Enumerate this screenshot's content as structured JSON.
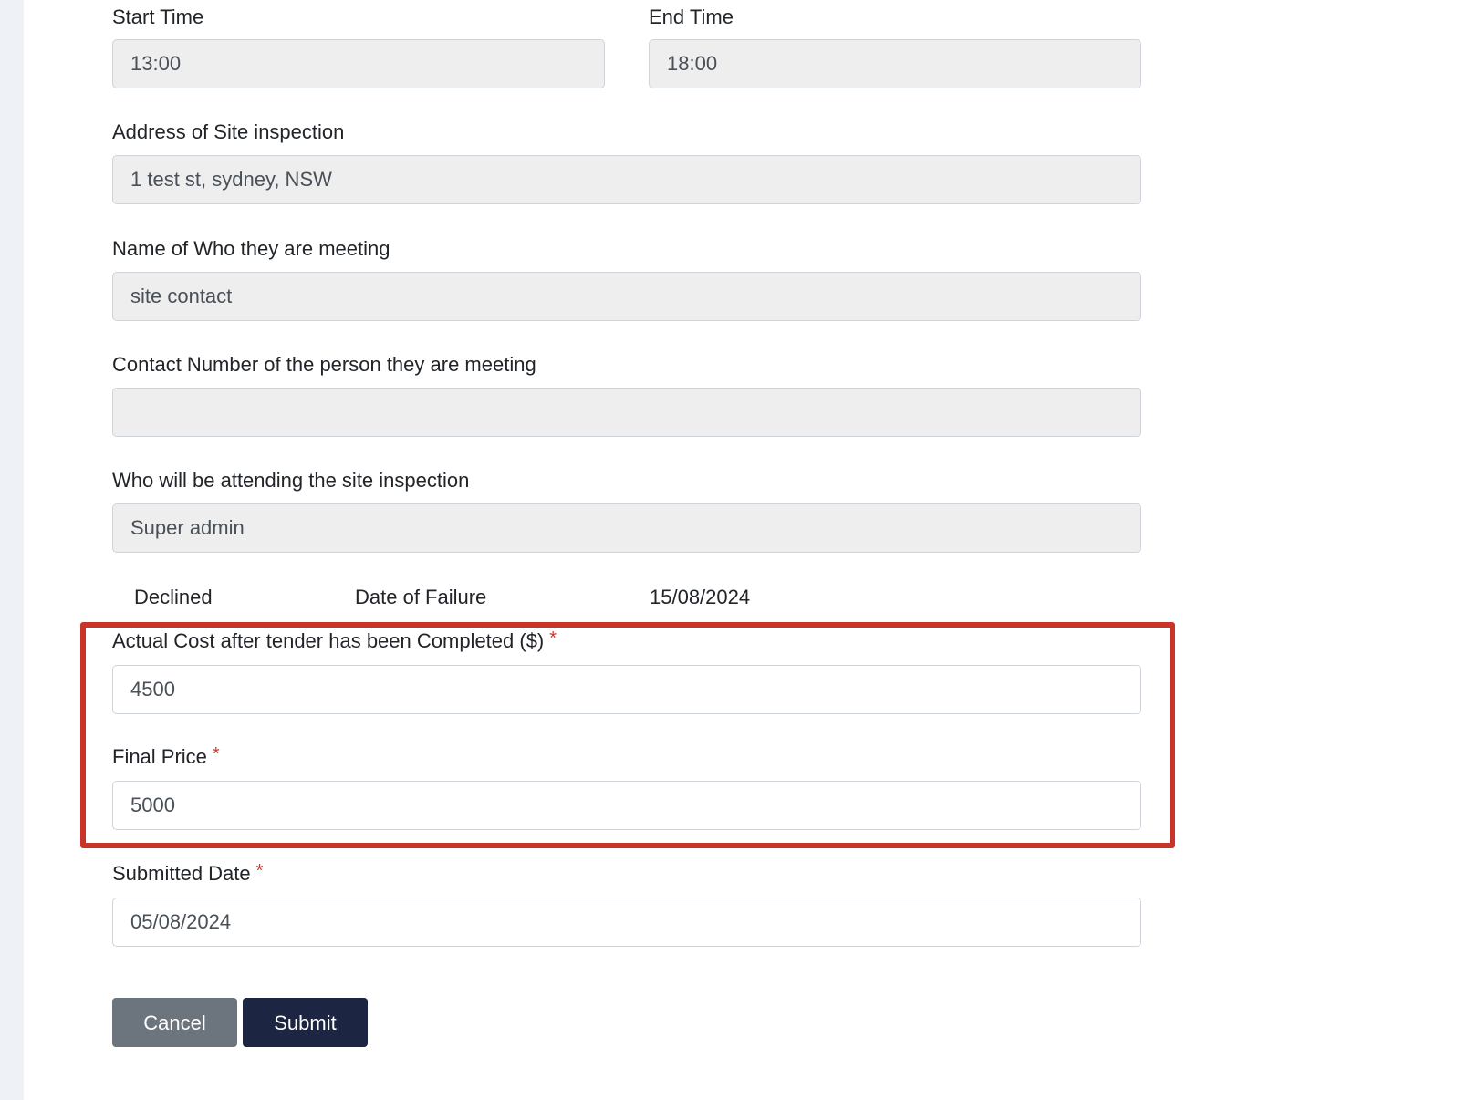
{
  "form": {
    "start_time": {
      "label": "Start Time",
      "value": "13:00"
    },
    "end_time": {
      "label": "End Time",
      "value": "18:00"
    },
    "address": {
      "label": "Address of Site inspection",
      "value": "1 test st, sydney, NSW"
    },
    "meeting_name": {
      "label": "Name of Who they are meeting",
      "value": "site contact"
    },
    "contact_number": {
      "label": "Contact Number of the person they are meeting",
      "value": ""
    },
    "attendee": {
      "label": "Who will be attending the site inspection",
      "value": "Super admin"
    },
    "status_row": {
      "status": "Declined",
      "failure_label": "Date of Failure",
      "failure_date": "15/08/2024"
    },
    "actual_cost": {
      "label": "Actual Cost after tender has been Completed ($)",
      "required_mark": "*",
      "value": "4500"
    },
    "final_price": {
      "label": "Final Price",
      "required_mark": "*",
      "value": "5000"
    },
    "submitted_date": {
      "label": "Submitted Date",
      "required_mark": "*",
      "value": "05/08/2024"
    }
  },
  "buttons": {
    "cancel_label": "Cancel",
    "submit_label": "Submit"
  },
  "colors": {
    "highlight_border": "#c9342a",
    "submit_bg": "#1c2541",
    "cancel_bg": "#6c757d",
    "readonly_bg": "#eeeeee"
  }
}
